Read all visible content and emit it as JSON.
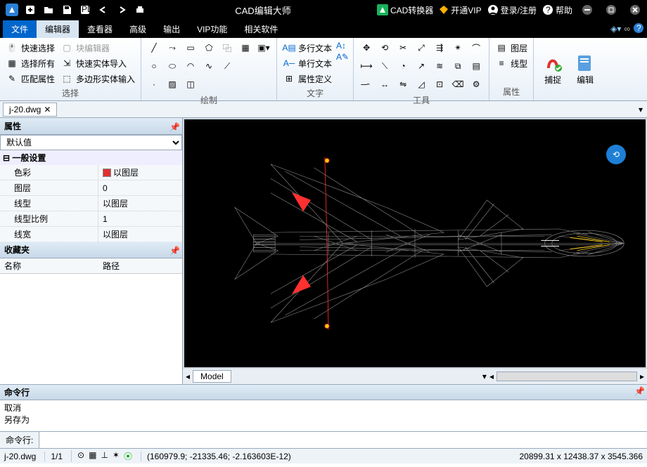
{
  "titlebar": {
    "app_title": "CAD编辑大师",
    "converter": "CAD转换器",
    "vip": "开通VIP",
    "login": "登录/注册",
    "help": "帮助"
  },
  "menu": {
    "tabs": [
      "文件",
      "编辑器",
      "查看器",
      "高级",
      "输出",
      "VIP功能",
      "相关软件"
    ]
  },
  "ribbon": {
    "select": {
      "quick": "快速选择",
      "block_editor": "块编辑器",
      "select_all": "选择所有",
      "import": "快速实体导入",
      "match": "匹配属性",
      "polyinput": "多边形实体输入",
      "label": "选择"
    },
    "draw": {
      "label": "绘制"
    },
    "text": {
      "mtext": "多行文本",
      "stext": "单行文本",
      "attdef": "属性定义",
      "label": "文字"
    },
    "tools": {
      "label": "工具"
    },
    "props": {
      "layer": "图层",
      "linetype": "线型",
      "label": "属性"
    },
    "snap": "捕捉",
    "edit": "编辑"
  },
  "filetab": {
    "name": "j-20.dwg"
  },
  "properties": {
    "title": "属性",
    "default": "默认值",
    "general": "一般设置",
    "rows": [
      {
        "k": "色彩",
        "v": "以图层",
        "swatch": true
      },
      {
        "k": "图层",
        "v": "0"
      },
      {
        "k": "线型",
        "v": "以图层"
      },
      {
        "k": "线型比例",
        "v": "1"
      },
      {
        "k": "线宽",
        "v": "以图层"
      }
    ]
  },
  "favorites": {
    "title": "收藏夹",
    "col_name": "名称",
    "col_path": "路径"
  },
  "model_tab": "Model",
  "cmdlog": {
    "title": "命令行",
    "lines": [
      "取消",
      "另存为"
    ]
  },
  "cmdline_label": "命令行:",
  "status": {
    "file": "j-20.dwg",
    "pages": "1/1",
    "coords": "(160979.9; -21335.46; -2.163603E-12)",
    "dims": "20899.31 x 12438.37 x 3545.366"
  }
}
